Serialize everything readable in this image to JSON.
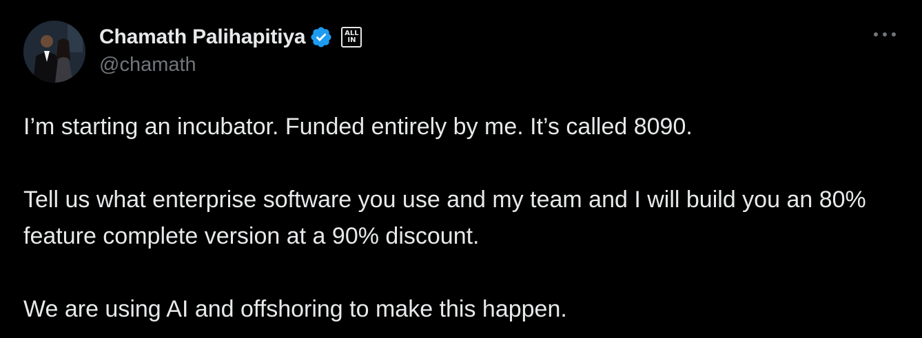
{
  "tweet": {
    "author": {
      "display_name": "Chamath Palihapitiya",
      "handle": "@chamath",
      "verified": true,
      "affiliate_badge": {
        "line1": "ALL",
        "line2": "IN"
      }
    },
    "more_icon": "more-horizontal-icon",
    "paragraphs": [
      "I’m starting an incubator. Funded entirely by me. It’s called 8090.",
      "Tell us what enterprise software you use and my team and I will build you an 80% feature complete version at a 90% discount.",
      "We are using AI and offshoring to make this happen."
    ]
  },
  "colors": {
    "background": "#000000",
    "text_primary": "#e7e9ea",
    "text_secondary": "#71767b",
    "verified_blue": "#1d9bf0"
  }
}
